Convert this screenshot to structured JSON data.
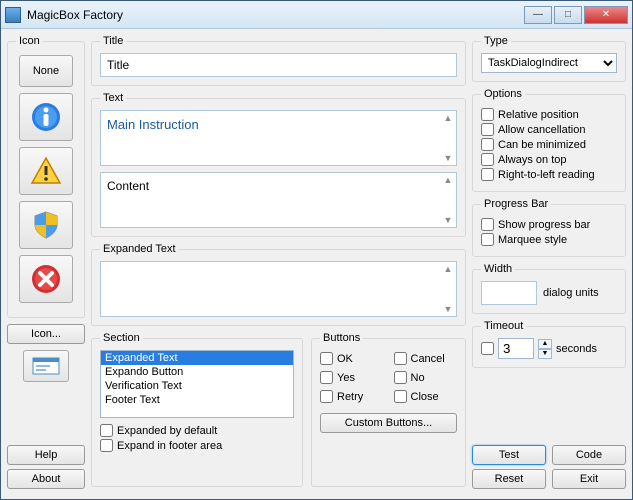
{
  "window": {
    "title": "MagicBox Factory"
  },
  "icon": {
    "legend": "Icon",
    "none_label": "None",
    "browse_label": "Icon..."
  },
  "left_buttons": {
    "help": "Help",
    "about": "About"
  },
  "title_group": {
    "legend": "Title",
    "value": "Title"
  },
  "text_group": {
    "legend": "Text",
    "main_instruction": "Main Instruction",
    "content": "Content"
  },
  "expanded_group": {
    "legend": "Expanded Text",
    "value": ""
  },
  "section": {
    "legend": "Section",
    "items": [
      "Expanded Text",
      "Expando Button",
      "Verification Text",
      "Footer Text"
    ],
    "expanded_default": "Expanded by default",
    "expand_footer": "Expand in footer area"
  },
  "buttons_group": {
    "legend": "Buttons",
    "ok": "OK",
    "cancel": "Cancel",
    "yes": "Yes",
    "no": "No",
    "retry": "Retry",
    "close": "Close",
    "custom": "Custom Buttons..."
  },
  "type_group": {
    "legend": "Type",
    "selected": "TaskDialogIndirect"
  },
  "options_group": {
    "legend": "Options",
    "relative": "Relative position",
    "allow_cancel": "Allow cancellation",
    "minimized": "Can be minimized",
    "always_top": "Always on top",
    "rtl": "Right-to-left reading"
  },
  "progress_group": {
    "legend": "Progress Bar",
    "show": "Show progress bar",
    "marquee": "Marquee style"
  },
  "width_group": {
    "legend": "Width",
    "value": "",
    "units": "dialog units"
  },
  "timeout_group": {
    "legend": "Timeout",
    "value": "3",
    "units": "seconds"
  },
  "action_buttons": {
    "test": "Test",
    "code": "Code",
    "reset": "Reset",
    "exit": "Exit"
  }
}
